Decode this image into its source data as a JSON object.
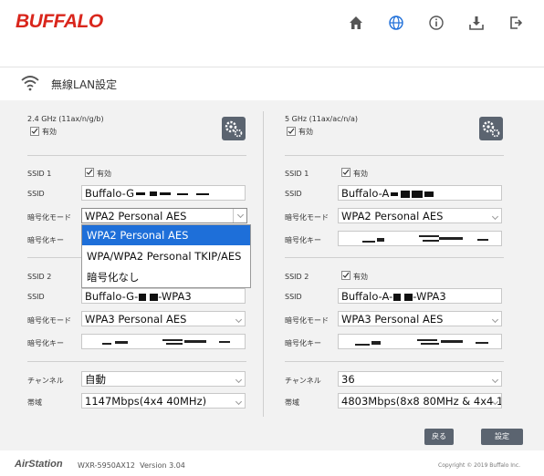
{
  "header": {
    "brand": "BUFFALO",
    "nav_icons": [
      "home-icon",
      "globe-icon",
      "info-icon",
      "download-icon",
      "logout-icon"
    ],
    "accent_color": "#d9261c"
  },
  "page": {
    "title": "無線LAN設定"
  },
  "left": {
    "band": "2.4 GHz (11ax/n/g/b)",
    "enabled_label": "有効",
    "ssid1": {
      "heading": "SSID 1",
      "enabled_label": "有効",
      "ssid_label": "SSID",
      "ssid_value": "Buffalo-G",
      "enc_label": "暗号化モード",
      "enc_value": "WPA2 Personal AES",
      "key_label": "暗号化キー"
    },
    "dropdown_options": [
      "WPA2 Personal AES",
      "WPA/WPA2 Personal TKIP/AES",
      "暗号化なし"
    ],
    "ssid2": {
      "heading": "SSID 2",
      "ssid_label": "SSID",
      "ssid_value_prefix": "Buffalo-G-",
      "ssid_value_suffix": "-WPA3",
      "enc_label": "暗号化モード",
      "enc_value": "WPA3 Personal AES",
      "key_label": "暗号化キー"
    },
    "channel_label": "チャンネル",
    "channel_value": "自動",
    "bandwidth_label": "帯域",
    "bandwidth_value": "1147Mbps(4x4 40MHz)"
  },
  "right": {
    "band": "5 GHz (11ax/ac/n/a)",
    "enabled_label": "有効",
    "ssid1": {
      "heading": "SSID 1",
      "enabled_label": "有効",
      "ssid_label": "SSID",
      "ssid_value": "Buffalo-A",
      "enc_label": "暗号化モード",
      "enc_value": "WPA2 Personal AES",
      "key_label": "暗号化キー"
    },
    "ssid2": {
      "heading": "SSID 2",
      "enabled_label": "有効",
      "ssid_label": "SSID",
      "ssid_value_prefix": "Buffalo-A-",
      "ssid_value_suffix": "-WPA3",
      "enc_label": "暗号化モード",
      "enc_value": "WPA3 Personal AES",
      "key_label": "暗号化キー"
    },
    "channel_label": "チャンネル",
    "channel_value": "36",
    "bandwidth_label": "帯域",
    "bandwidth_value": "4803Mbps(8x8 80MHz & 4x4 1"
  },
  "buttons": {
    "back": "戻る",
    "apply": "設定"
  },
  "footer": {
    "logo": "AirStation",
    "model": "WXR-5950AX12",
    "version": "Version 3.04",
    "copyright": "Copyright © 2019 Buffalo Inc."
  }
}
